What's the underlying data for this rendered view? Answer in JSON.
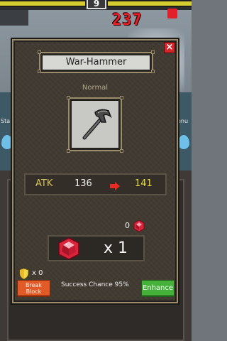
{
  "hud": {
    "level": "9",
    "damage": "237"
  },
  "background": {
    "left_side_label": "Sta",
    "right_side_label": "enu"
  },
  "dialog": {
    "title": "War-Hammer",
    "rarity": "Normal",
    "close_label": "×",
    "item_icon": "war-hammer-icon",
    "stat": {
      "label": "ATK",
      "current": "136",
      "next": "141",
      "arrow_icon": "right-arrow-icon"
    },
    "owned_gems": "0",
    "cost": "x 1",
    "shields": "x 0",
    "break_button": [
      "Break",
      "Block"
    ],
    "success_chance": "Success Chance 95%",
    "enhance_button": "Enhance"
  },
  "colors": {
    "panel": "#403a31",
    "frame": "#9b8c6e",
    "atk_label": "#d8c25b",
    "atk_next": "#ecdd3c",
    "break_button": "#e25a27",
    "enhance_button": "#45b13a",
    "close_button": "#d2262a",
    "gem": "#d8233a"
  }
}
